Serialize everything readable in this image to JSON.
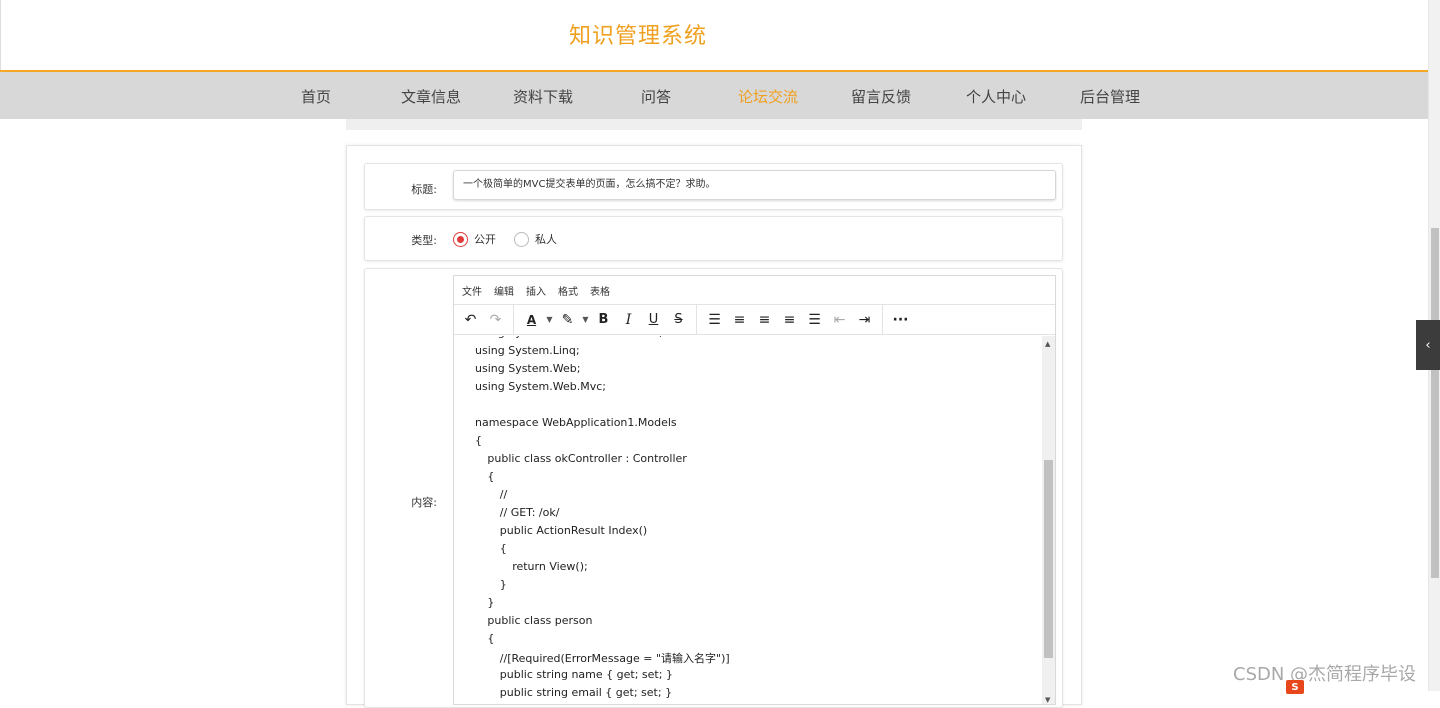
{
  "site": {
    "title": "知识管理系统"
  },
  "nav": {
    "items": [
      {
        "label": "首页"
      },
      {
        "label": "文章信息"
      },
      {
        "label": "资料下载"
      },
      {
        "label": "问答"
      },
      {
        "label": "论坛交流",
        "active": true
      },
      {
        "label": "留言反馈"
      },
      {
        "label": "个人中心"
      },
      {
        "label": "后台管理"
      }
    ]
  },
  "form": {
    "title_label": "标题:",
    "title_value": "一个极简单的MVC提交表单的页面，怎么搞不定？求助。",
    "type_label": "类型:",
    "type_options": [
      {
        "label": "公开",
        "checked": true
      },
      {
        "label": "私人",
        "checked": false
      }
    ],
    "content_label": "内容:"
  },
  "editor": {
    "menu": [
      "文件",
      "编辑",
      "插入",
      "格式",
      "表格"
    ],
    "toolbar_icons": [
      "undo-icon",
      "redo-icon",
      "text-color-icon",
      "highlight-icon",
      "bold-icon",
      "italic-icon",
      "underline-icon",
      "strikethrough-icon",
      "line-height-icon",
      "align-left-icon",
      "align-center-icon",
      "align-right-icon",
      "align-justify-icon",
      "outdent-icon",
      "indent-icon",
      "more-icon"
    ],
    "lines": [
      "using System.Collections.Generic;",
      "using System.Linq;",
      "using System.Web;",
      "using System.Web.Mvc;",
      "",
      "namespace WebApplication1.Models",
      "{",
      "    public class okController : Controller",
      "    {",
      "        //",
      "        // GET: /ok/",
      "        public ActionResult Index()",
      "        {",
      "            return View();",
      "        }",
      "    }",
      "    public class person",
      "    {",
      "        //[Required(ErrorMessage = \"请输入名字\")]",
      "        public string name { get; set; }",
      "        public string email { get; set; }"
    ]
  },
  "watermark": {
    "text": "CSDN @杰简程序毕设"
  },
  "tray": {
    "s_label": "S"
  },
  "colors": {
    "accent": "#f0a020",
    "nav_bg": "#d8d8d8",
    "radio_checked": "#e03b3b"
  }
}
